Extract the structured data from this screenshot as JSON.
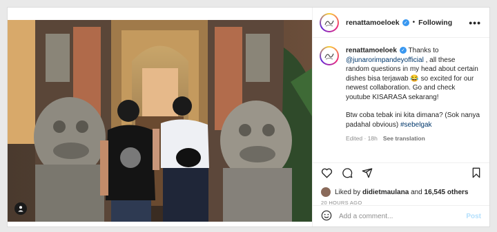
{
  "post": {
    "username": "renattamoeloek",
    "follow_label": "Following",
    "more_label": "•••",
    "caption": {
      "username": "renattamoeloek",
      "text_before_link": " Thanks to ",
      "mention": "@junarorimpandeyofficial",
      "text_after_link": " , all these random questions in my head about certain dishes bisa terjawab 😂 so excited for our newest collaboration. Go and check youtube KISARASA sekarang!",
      "paragraph2": "Btw coba tebak ini kita dimana? (Sok nanya padahal obvious) ",
      "hashtag": "#sebelgak"
    },
    "edited_label": "Edited · 18h",
    "see_translation": "See translation",
    "likes": {
      "liked_by": "Liked by ",
      "user": "didietmaulana",
      "and": " and ",
      "count": "16,545 others"
    },
    "time_ago": "20 HOURS AGO",
    "comment": {
      "placeholder": "Add a comment...",
      "post_label": "Post"
    }
  },
  "icons": {
    "more": "more-icon",
    "verified": "verified-icon",
    "like": "heart-icon",
    "comment": "comment-icon",
    "share": "share-icon",
    "save": "bookmark-icon",
    "emoji": "emoji-icon",
    "tag": "user-tag-icon"
  },
  "colors": {
    "verified": "#3897f0",
    "link": "#00376b",
    "post_button": "#b2dffc"
  }
}
